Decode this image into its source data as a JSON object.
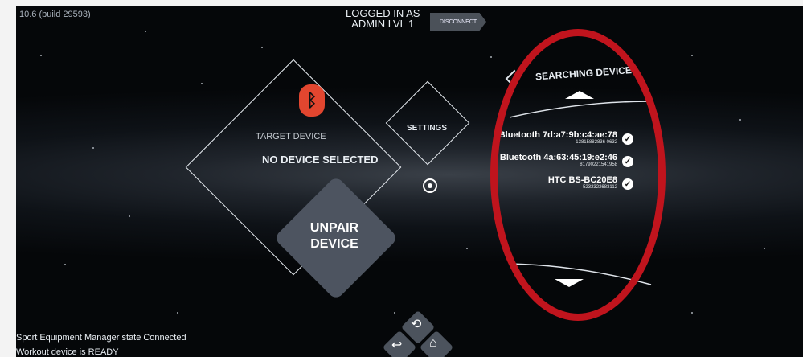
{
  "header": {
    "build_text": "10.6 (build 29593)",
    "logged_in_line1": "LOGGED IN AS",
    "logged_in_line2": "ADMIN LVL 1",
    "disconnect_label": "DISCONNECT"
  },
  "main_panel": {
    "target_label": "TARGET DEVICE",
    "device_status": "NO DEVICE SELECTED",
    "settings_label": "SETTINGS",
    "unpair_line1": "UNPAIR",
    "unpair_line2": "DEVICE"
  },
  "device_list": {
    "title": "SEARCHING DEVICES",
    "items": [
      {
        "name": "Bluetooth 7d:a7:9b:c4:ae:78",
        "serial": "13815882836 0632"
      },
      {
        "name": "Bluetooth 4a:63:45:19:e2:46",
        "serial": "81790221541958"
      },
      {
        "name": "HTC BS-BC20E8",
        "serial": "5232322683112"
      }
    ]
  },
  "status": {
    "line1": "Sport Equipment Manager state Connected",
    "line2": "Workout device is  READY"
  },
  "colors": {
    "accent_red": "#c0141d",
    "bluetooth_badge": "#e2462f"
  }
}
